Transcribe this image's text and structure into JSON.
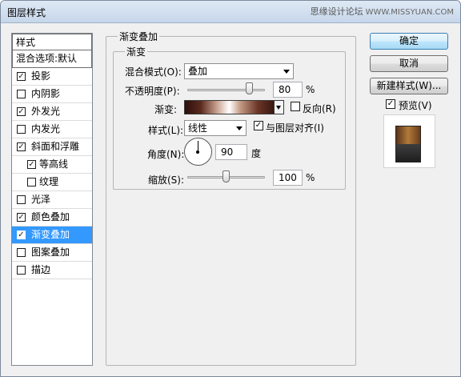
{
  "window": {
    "title": "图层样式"
  },
  "watermark": {
    "text": "思缘设计论坛",
    "url": "WWW.MISSYUAN.COM"
  },
  "style_list": {
    "header": "样式",
    "blend_default": "混合选项:默认",
    "items": [
      {
        "label": "投影",
        "checked": true,
        "indent": false,
        "active": false
      },
      {
        "label": "内阴影",
        "checked": false,
        "indent": false,
        "active": false
      },
      {
        "label": "外发光",
        "checked": true,
        "indent": false,
        "active": false
      },
      {
        "label": "内发光",
        "checked": false,
        "indent": false,
        "active": false
      },
      {
        "label": "斜面和浮雕",
        "checked": true,
        "indent": false,
        "active": false
      },
      {
        "label": "等高线",
        "checked": true,
        "indent": true,
        "active": false
      },
      {
        "label": "纹理",
        "checked": false,
        "indent": true,
        "active": false
      },
      {
        "label": "光泽",
        "checked": false,
        "indent": false,
        "active": false
      },
      {
        "label": "颜色叠加",
        "checked": true,
        "indent": false,
        "active": false
      },
      {
        "label": "渐变叠加",
        "checked": true,
        "indent": false,
        "active": true
      },
      {
        "label": "图案叠加",
        "checked": false,
        "indent": false,
        "active": false
      },
      {
        "label": "描边",
        "checked": false,
        "indent": false,
        "active": false
      }
    ]
  },
  "panel": {
    "group_title": "渐变叠加",
    "subgroup_title": "渐变",
    "blend_mode": {
      "label": "混合模式(O):",
      "value": "叠加"
    },
    "opacity": {
      "label": "不透明度(P):",
      "value": "80",
      "unit": "%",
      "level": 0.8
    },
    "gradient": {
      "label": "渐变:",
      "reverse_label": "反向(R)",
      "reverse_checked": false
    },
    "style": {
      "label": "样式(L):",
      "value": "线性",
      "align_label": "与图层对齐(I)",
      "align_checked": true
    },
    "angle": {
      "label": "角度(N):",
      "value": "90",
      "unit": "度"
    },
    "scale": {
      "label": "缩放(S):",
      "value": "100",
      "unit": "%",
      "level": 0.5
    }
  },
  "buttons": {
    "ok": "确定",
    "cancel": "取消",
    "new_style": "新建样式(W)...",
    "preview_label": "预览(V)",
    "preview_checked": true
  },
  "colors": {
    "active_item": "#3399ff",
    "window_bg": "#f0f0f0"
  }
}
